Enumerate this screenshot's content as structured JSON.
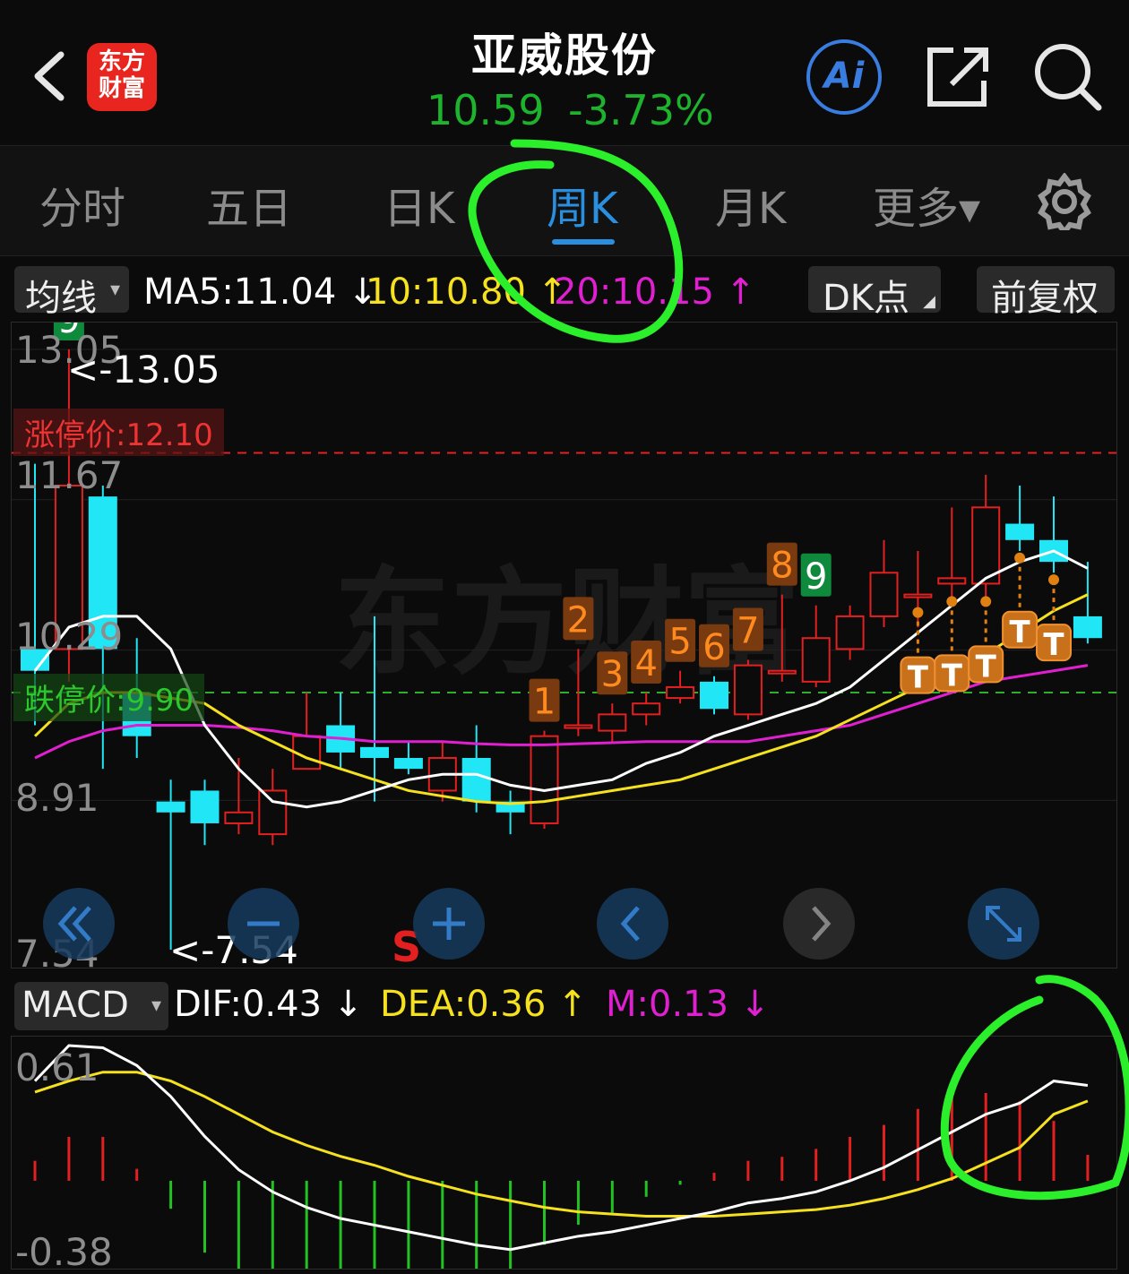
{
  "header": {
    "logo_text": "东方财富",
    "stock_name": "亚威股份",
    "price": "10.59",
    "change_pct": "-3.73%",
    "ai_label": "Ai"
  },
  "tabs": [
    {
      "label": "分时"
    },
    {
      "label": "五日"
    },
    {
      "label": "日K"
    },
    {
      "label": "周K"
    },
    {
      "label": "月K"
    },
    {
      "label": "更多▾"
    }
  ],
  "ma_row": {
    "selector": "均线",
    "ma5": "MA5:11.04 ↓",
    "ma10": "10:10.80 ↑",
    "ma20": "20:10.15 ↑",
    "dk_button": "DK点",
    "fq_button": "前复权"
  },
  "main_chart": {
    "y_top": "13.05",
    "y_mid_high": "11.67",
    "y_mid": "10.29",
    "y_mid_low": "8.91",
    "y_bottom": "7.54",
    "high_hint": "<-13.05",
    "low_hint": "<-7.54",
    "limit_up_label": "涨停价:12.10",
    "limit_down_label": "跌停价:9.90",
    "sell_marker": "S",
    "watermark": "东方财富"
  },
  "macd_row": {
    "selector": "MACD",
    "dif": "DIF:0.43 ↓",
    "dea": "DEA:0.36 ↑",
    "m": "M:0.13 ↓"
  },
  "macd_chart": {
    "y_top": "0.61",
    "y_bottom": "-0.38"
  },
  "colors": {
    "up": "#e32020",
    "down": "#21e6f5",
    "ma5": "#ffffff",
    "ma10": "#f5e11e",
    "ma20": "#e020d0",
    "annotation_green": "#2bef2b",
    "accent_blue": "#2b8fe0"
  },
  "chart_data": {
    "type": "candlestick",
    "ylim": [
      7.54,
      13.05
    ],
    "candles": [
      {
        "o": 10.3,
        "c": 10.1,
        "h": 12.0,
        "l": 9.6
      },
      {
        "o": 10.3,
        "c": 11.8,
        "h": 13.05,
        "l": 10.0
      },
      {
        "o": 11.7,
        "c": 10.3,
        "h": 11.8,
        "l": 9.2
      },
      {
        "o": 9.9,
        "c": 9.5,
        "h": 10.4,
        "l": 9.3
      },
      {
        "o": 8.9,
        "c": 8.8,
        "h": 9.1,
        "l": 7.54
      },
      {
        "o": 9.0,
        "c": 8.7,
        "h": 9.1,
        "l": 8.5
      },
      {
        "o": 8.7,
        "c": 8.8,
        "h": 9.3,
        "l": 8.6
      },
      {
        "o": 8.6,
        "c": 9.0,
        "h": 9.2,
        "l": 8.5
      },
      {
        "o": 9.2,
        "c": 9.5,
        "h": 9.9,
        "l": 9.2
      },
      {
        "o": 9.6,
        "c": 9.35,
        "h": 9.9,
        "l": 9.2
      },
      {
        "o": 9.4,
        "c": 9.3,
        "h": 10.6,
        "l": 8.9
      },
      {
        "o": 9.3,
        "c": 9.2,
        "h": 9.45,
        "l": 9.15
      },
      {
        "o": 9.0,
        "c": 9.3,
        "h": 9.45,
        "l": 8.9
      },
      {
        "o": 9.3,
        "c": 8.9,
        "h": 9.6,
        "l": 8.8
      },
      {
        "o": 8.9,
        "c": 8.8,
        "h": 9.0,
        "l": 8.6
      },
      {
        "o": 8.7,
        "c": 9.5,
        "h": 9.55,
        "l": 8.65
      },
      {
        "o": 9.6,
        "c": 9.6,
        "h": 10.3,
        "l": 9.5
      },
      {
        "o": 9.55,
        "c": 9.7,
        "h": 9.8,
        "l": 9.45
      },
      {
        "o": 9.7,
        "c": 9.8,
        "h": 9.9,
        "l": 9.6
      },
      {
        "o": 9.85,
        "c": 9.95,
        "h": 10.1,
        "l": 9.8
      },
      {
        "o": 10.0,
        "c": 9.75,
        "h": 10.05,
        "l": 9.7
      },
      {
        "o": 9.7,
        "c": 10.15,
        "h": 10.2,
        "l": 9.65
      },
      {
        "o": 10.1,
        "c": 10.1,
        "h": 10.8,
        "l": 10.0
      },
      {
        "o": 10.0,
        "c": 10.4,
        "h": 10.7,
        "l": 9.95
      },
      {
        "o": 10.3,
        "c": 10.6,
        "h": 10.7,
        "l": 10.2
      },
      {
        "o": 10.6,
        "c": 11.0,
        "h": 11.3,
        "l": 10.5
      },
      {
        "o": 10.8,
        "c": 10.8,
        "h": 11.2,
        "l": 10.5
      },
      {
        "o": 10.9,
        "c": 10.95,
        "h": 11.6,
        "l": 10.7
      },
      {
        "o": 10.9,
        "c": 11.6,
        "h": 11.9,
        "l": 10.7
      },
      {
        "o": 11.45,
        "c": 11.3,
        "h": 11.8,
        "l": 11.2
      },
      {
        "o": 11.3,
        "c": 11.1,
        "h": 11.7,
        "l": 11.0
      },
      {
        "o": 10.6,
        "c": 10.4,
        "h": 11.1,
        "l": 10.35
      }
    ],
    "ma5": [
      10.1,
      10.5,
      10.6,
      10.6,
      10.3,
      9.6,
      9.2,
      8.9,
      8.85,
      8.9,
      9.0,
      9.1,
      9.15,
      9.15,
      9.05,
      9.0,
      9.05,
      9.1,
      9.25,
      9.35,
      9.5,
      9.6,
      9.7,
      9.8,
      9.95,
      10.2,
      10.45,
      10.7,
      10.95,
      11.1,
      11.2,
      11.04
    ],
    "ma10": [
      9.5,
      9.8,
      9.9,
      9.9,
      9.85,
      9.8,
      9.6,
      9.45,
      9.3,
      9.2,
      9.1,
      9.0,
      8.95,
      8.9,
      8.88,
      8.9,
      8.95,
      9.0,
      9.05,
      9.1,
      9.2,
      9.3,
      9.4,
      9.5,
      9.65,
      9.8,
      9.95,
      10.1,
      10.25,
      10.45,
      10.65,
      10.8
    ],
    "ma20": [
      9.3,
      9.45,
      9.55,
      9.6,
      9.6,
      9.6,
      9.58,
      9.55,
      9.5,
      9.48,
      9.45,
      9.45,
      9.45,
      9.43,
      9.42,
      9.42,
      9.43,
      9.44,
      9.45,
      9.45,
      9.45,
      9.45,
      9.5,
      9.55,
      9.6,
      9.7,
      9.8,
      9.9,
      10.0,
      10.05,
      10.1,
      10.15
    ],
    "macd": {
      "ylim": [
        -0.38,
        0.61
      ],
      "dif": [
        0.45,
        0.61,
        0.6,
        0.52,
        0.38,
        0.2,
        0.05,
        -0.05,
        -0.12,
        -0.17,
        -0.2,
        -0.23,
        -0.26,
        -0.29,
        -0.31,
        -0.28,
        -0.25,
        -0.23,
        -0.2,
        -0.17,
        -0.14,
        -0.1,
        -0.08,
        -0.05,
        0.0,
        0.06,
        0.14,
        0.22,
        0.3,
        0.35,
        0.45,
        0.43
      ],
      "dea": [
        0.4,
        0.45,
        0.49,
        0.49,
        0.45,
        0.38,
        0.3,
        0.22,
        0.16,
        0.11,
        0.07,
        0.02,
        -0.02,
        -0.06,
        -0.09,
        -0.12,
        -0.14,
        -0.15,
        -0.16,
        -0.16,
        -0.16,
        -0.15,
        -0.14,
        -0.13,
        -0.11,
        -0.08,
        -0.04,
        0.01,
        0.08,
        0.15,
        0.3,
        0.36
      ],
      "m": [
        0.1,
        0.22,
        0.22,
        0.06,
        -0.14,
        -0.36,
        -0.5,
        -0.54,
        -0.56,
        -0.56,
        -0.54,
        -0.5,
        -0.48,
        -0.46,
        -0.44,
        -0.32,
        -0.22,
        -0.16,
        -0.08,
        -0.02,
        0.04,
        0.1,
        0.12,
        0.16,
        0.22,
        0.28,
        0.36,
        0.42,
        0.44,
        0.4,
        0.3,
        0.13
      ]
    },
    "nine_markers": [
      {
        "i": 15,
        "label": "1"
      },
      {
        "i": 16,
        "label": "2"
      },
      {
        "i": 17,
        "label": "3"
      },
      {
        "i": 18,
        "label": "4"
      },
      {
        "i": 19,
        "label": "5"
      },
      {
        "i": 20,
        "label": "6"
      },
      {
        "i": 21,
        "label": "7"
      },
      {
        "i": 22,
        "label": "8"
      },
      {
        "i": 23,
        "label": "9"
      },
      {
        "i": 1,
        "label": "9"
      }
    ],
    "t_markers": [
      26,
      27,
      28,
      29,
      30
    ],
    "t_label": "T"
  }
}
